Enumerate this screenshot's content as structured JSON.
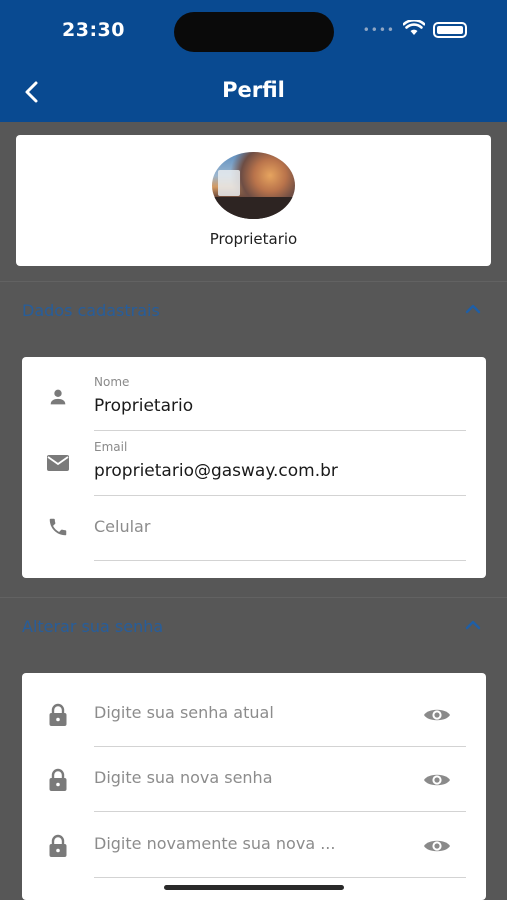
{
  "status_bar": {
    "time": "23:30"
  },
  "header": {
    "title": "Perfil",
    "back_icon": "chevron-left-icon"
  },
  "profile": {
    "name": "Proprietario"
  },
  "sections": {
    "personal": {
      "title": "Dados cadastrais"
    },
    "password": {
      "title": "Alterar sua senha"
    }
  },
  "personal_fields": {
    "name": {
      "label": "Nome",
      "value": "Proprietario",
      "icon": "person-icon"
    },
    "email": {
      "label": "Email",
      "value": "proprietario@gasway.com.br",
      "icon": "mail-icon"
    },
    "phone": {
      "placeholder": "Celular",
      "icon": "phone-icon"
    }
  },
  "password_fields": {
    "current": {
      "placeholder": "Digite sua senha atual"
    },
    "new": {
      "placeholder": "Digite sua nova senha"
    },
    "confirm": {
      "placeholder": "Digite novamente sua nova ..."
    }
  },
  "colors": {
    "header": "#094a91",
    "accent": "#1f5fa6",
    "overlay": "#575757",
    "card": "#ffffff"
  }
}
